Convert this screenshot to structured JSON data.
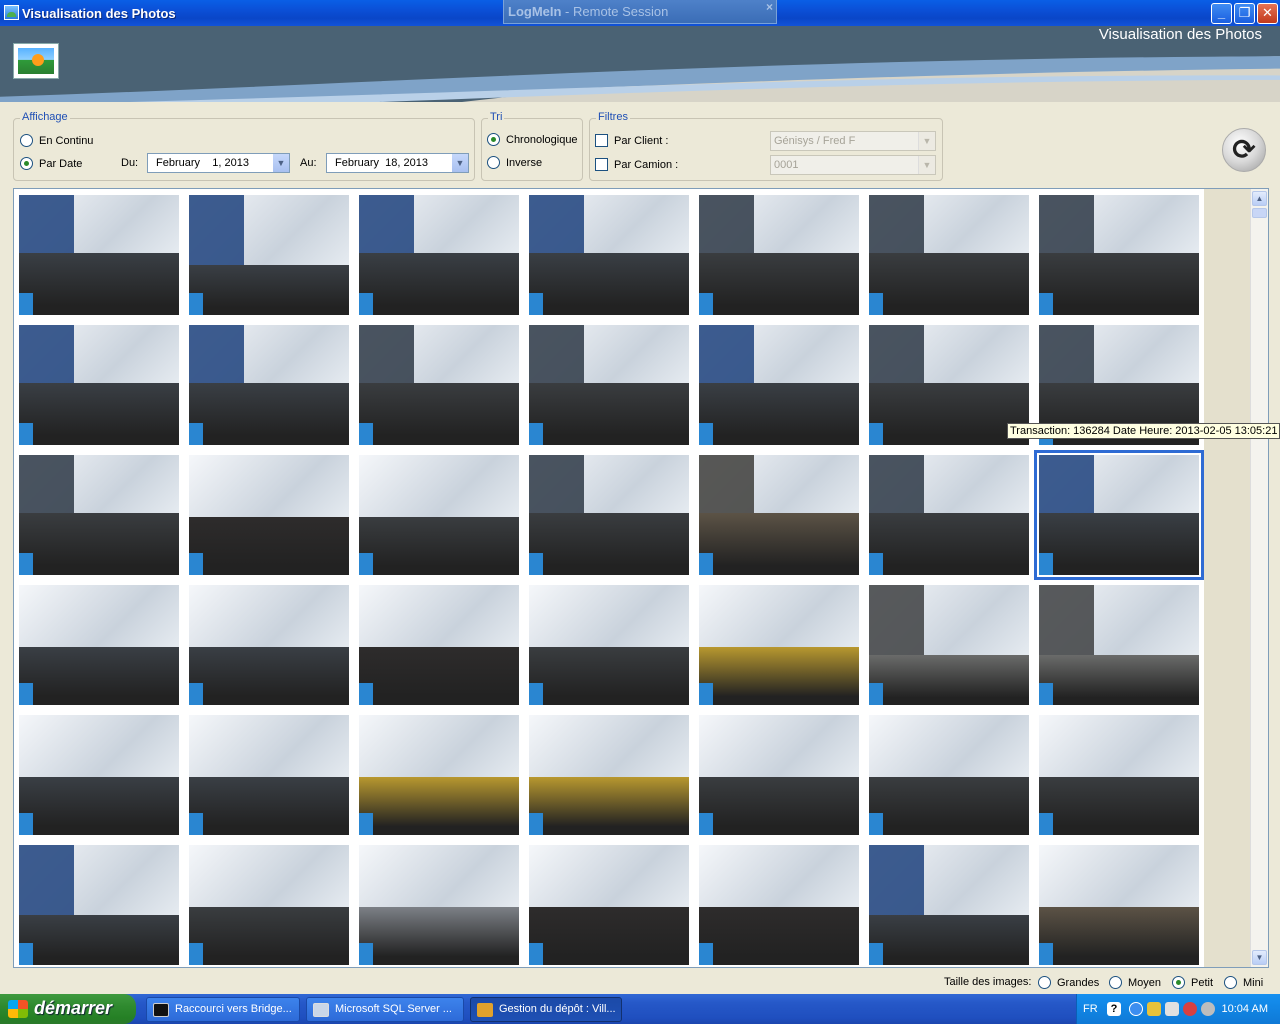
{
  "window": {
    "title": "Visualisation des Photos",
    "logmein_brand": "LogMeIn",
    "logmein_session": " - Remote Session",
    "logmein_close": "×"
  },
  "banner": {
    "title": "Visualisation des Photos"
  },
  "affichage": {
    "legend": "Affichage",
    "option_continu": "En Continu",
    "option_par_date": "Par Date",
    "selected": "Par Date",
    "du_label": "Du:",
    "du_value": "February    1, 2013",
    "au_label": "Au:",
    "au_value": "February  18, 2013"
  },
  "tri": {
    "legend": "Tri",
    "option_chrono": "Chronologique",
    "option_inverse": "Inverse",
    "selected": "Chronologique"
  },
  "filtres": {
    "legend": "Filtres",
    "par_client_label": "Par Client :",
    "par_client_value": "Génisys / Fred F",
    "par_camion_label": "Par Camion :",
    "par_camion_value": "0001"
  },
  "icons": {
    "refresh": "refresh-icon",
    "dropdown": "chevron-down-icon"
  },
  "gallery": {
    "rows": 6,
    "columns": 7,
    "selected_index": 20,
    "photos": [
      {
        "tone": "blue",
        "snow": "high"
      },
      {
        "tone": "blue",
        "snow": "low"
      },
      {
        "tone": "blue",
        "snow": "high"
      },
      {
        "tone": "blue",
        "snow": "high"
      },
      {
        "tone": "dark",
        "snow": "high"
      },
      {
        "tone": "dark",
        "snow": "high"
      },
      {
        "tone": "dark",
        "snow": "high"
      },
      {
        "tone": "blue",
        "snow": "high"
      },
      {
        "tone": "blue",
        "snow": "high"
      },
      {
        "tone": "dark",
        "snow": "high"
      },
      {
        "tone": "dark",
        "snow": "high"
      },
      {
        "tone": "blue",
        "snow": "high"
      },
      {
        "tone": "dark",
        "snow": "high"
      },
      {
        "tone": "dark",
        "snow": "high"
      },
      {
        "tone": "dark",
        "snow": "high"
      },
      {
        "tone": "red",
        "snow": "full"
      },
      {
        "tone": "dark",
        "snow": "full"
      },
      {
        "tone": "dark",
        "snow": "high"
      },
      {
        "tone": "tan",
        "snow": "high"
      },
      {
        "tone": "dark",
        "snow": "high"
      },
      {
        "tone": "blue",
        "snow": "high"
      },
      {
        "tone": "blue",
        "snow": "full"
      },
      {
        "tone": "blue",
        "snow": "full"
      },
      {
        "tone": "red",
        "snow": "full"
      },
      {
        "tone": "dark",
        "snow": "full"
      },
      {
        "tone": "yellow",
        "snow": "full"
      },
      {
        "tone": "road",
        "snow": "low"
      },
      {
        "tone": "road",
        "snow": "low"
      },
      {
        "tone": "blue",
        "snow": "full"
      },
      {
        "tone": "blue",
        "snow": "full"
      },
      {
        "tone": "yellow",
        "snow": "full"
      },
      {
        "tone": "yellow",
        "snow": "full"
      },
      {
        "tone": "dark",
        "snow": "full"
      },
      {
        "tone": "dark",
        "snow": "full"
      },
      {
        "tone": "dark",
        "snow": "full"
      },
      {
        "tone": "blue",
        "snow": "low"
      },
      {
        "tone": "dark",
        "snow": "full"
      },
      {
        "tone": "grey",
        "snow": "full"
      },
      {
        "tone": "red",
        "snow": "full"
      },
      {
        "tone": "red",
        "snow": "full"
      },
      {
        "tone": "blue",
        "snow": "low"
      },
      {
        "tone": "tan",
        "snow": "full"
      }
    ],
    "tooltip": "Transaction: 136284 Date Heure: 2013-02-05 13:05:21"
  },
  "image_size": {
    "label": "Taille des images:",
    "options": [
      "Grandes",
      "Moyen",
      "Petit",
      "Mini"
    ],
    "selected": "Petit"
  },
  "taskbar": {
    "start": "démarrer",
    "tasks": [
      {
        "label": "Raccourci vers Bridge...",
        "icon": "cmd-icon"
      },
      {
        "label": "Microsoft SQL Server ...",
        "icon": "sql-server-icon"
      },
      {
        "label": "Gestion du dépôt : Vill...",
        "icon": "app-icon"
      }
    ],
    "lang": "FR",
    "clock": "10:04 AM"
  }
}
